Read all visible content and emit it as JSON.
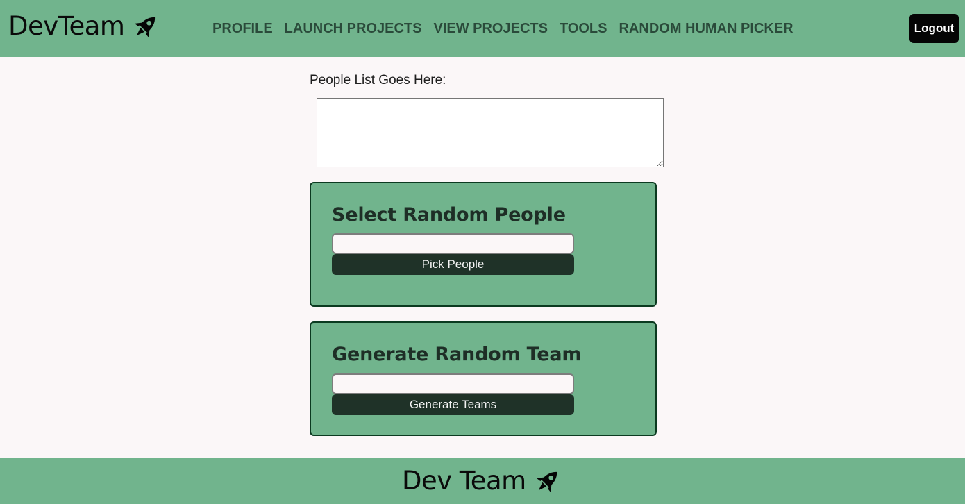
{
  "navbar": {
    "brand": "DevTeam",
    "brand_icon": "rocket-icon",
    "links": [
      {
        "label": "PROFILE"
      },
      {
        "label": "LAUNCH PROJECTS"
      },
      {
        "label": "VIEW PROJECTS"
      },
      {
        "label": "TOOLS"
      },
      {
        "label": "RANDOM HUMAN PICKER"
      }
    ],
    "logout_label": "Logout"
  },
  "people": {
    "label": "People List Goes Here:",
    "value": ""
  },
  "select_card": {
    "title": "Select Random People",
    "input_value": "",
    "button_label": "Pick People"
  },
  "team_card": {
    "title": "Generate Random Team",
    "input_value": "",
    "button_label": "Generate Teams"
  },
  "footer": {
    "brand": "Dev Team",
    "brand_icon": "rocket-icon"
  },
  "colors": {
    "accent": "#71b48d",
    "dark_button": "#1f3228",
    "logout": "#050505",
    "page_bg": "#fbf7f8"
  }
}
